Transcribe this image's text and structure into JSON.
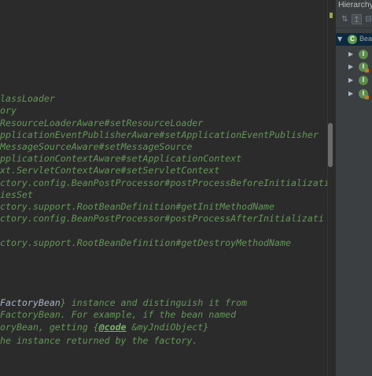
{
  "editor": {
    "lines": [
      {
        "parts": [
          {
            "t": "lassLoader",
            "c": "doc"
          }
        ]
      },
      {
        "parts": [
          {
            "t": "ory",
            "c": "doc"
          }
        ]
      },
      {
        "parts": [
          {
            "t": "ResourceLoaderAware#",
            "c": "doc"
          },
          {
            "t": "setResourceLoader",
            "c": "doc"
          }
        ]
      },
      {
        "parts": [
          {
            "t": "pplicationEventPublisherAware#",
            "c": "doc"
          },
          {
            "t": "setApplicationEventPublisher",
            "c": "doc"
          }
        ]
      },
      {
        "parts": [
          {
            "t": "MessageSourceAware#",
            "c": "doc"
          },
          {
            "t": "setMessageSource",
            "c": "doc"
          }
        ]
      },
      {
        "parts": [
          {
            "t": "pplicationContextAware#",
            "c": "doc"
          },
          {
            "t": "setApplicationContext",
            "c": "doc"
          }
        ]
      },
      {
        "parts": [
          {
            "t": "xt.ServletContextAware#",
            "c": "doc"
          },
          {
            "t": "setServletContext",
            "c": "doc"
          }
        ]
      },
      {
        "parts": [
          {
            "t": "ctory.config.BeanPostProcessor#",
            "c": "doc"
          },
          {
            "t": "postProcessBeforeInitializati",
            "c": "doc"
          }
        ]
      },
      {
        "parts": [
          {
            "t": "iesSet",
            "c": "doc"
          }
        ]
      },
      {
        "parts": [
          {
            "t": "ctory.support.RootBeanDefinition#",
            "c": "doc"
          },
          {
            "t": "getInitMethodName",
            "c": "doc"
          }
        ]
      },
      {
        "parts": [
          {
            "t": "ctory.config.BeanPostProcessor#",
            "c": "doc"
          },
          {
            "t": "postProcessAfterInitializati",
            "c": "doc"
          }
        ]
      },
      {
        "parts": [
          {
            "t": "",
            "c": "doc"
          }
        ]
      },
      {
        "parts": [
          {
            "t": "ctory.support.RootBeanDefinition#",
            "c": "doc"
          },
          {
            "t": "getDestroyMethodName",
            "c": "doc"
          }
        ]
      },
      {
        "parts": [
          {
            "t": "FactoryBean",
            "c": "plain"
          },
          {
            "t": "} instance and distinguish it from",
            "c": "doc"
          }
        ]
      },
      {
        "parts": [
          {
            "t": "FactoryBean. For example, if the bean named",
            "c": "doc"
          }
        ]
      },
      {
        "parts": [
          {
            "t": "oryBean, getting {",
            "c": "doc"
          },
          {
            "t": "@code",
            "c": "tag"
          },
          {
            "t": " &myJndiObject}",
            "c": "doc"
          }
        ]
      },
      {
        "parts": [
          {
            "t": "he instance returned by the factory.",
            "c": "doc"
          }
        ]
      }
    ]
  },
  "panel": {
    "title": "Hierarchy",
    "toolbar": [
      {
        "icon": "hierarchy-icon",
        "glyph": "⇅",
        "active": false
      },
      {
        "icon": "supertypes-icon",
        "glyph": "↥",
        "active": true
      },
      {
        "icon": "subtypes-icon",
        "glyph": "⊟",
        "active": false
      }
    ],
    "tree": [
      {
        "expanded": true,
        "icon_letter": "C",
        "selected": true,
        "more": "Bea"
      },
      {
        "expanded": false,
        "icon_letter": "I"
      },
      {
        "expanded": false,
        "icon_letter": "I",
        "orange": true
      },
      {
        "expanded": false,
        "icon_letter": "I"
      },
      {
        "expanded": false,
        "icon_letter": "I",
        "orange": true
      }
    ]
  },
  "colors": {
    "editor_bg": "#2b2b2b",
    "javadoc": "#629755",
    "panel_bg": "#3c3f41",
    "selection": "#0d293e",
    "class_icon": "#5c9a4b"
  }
}
